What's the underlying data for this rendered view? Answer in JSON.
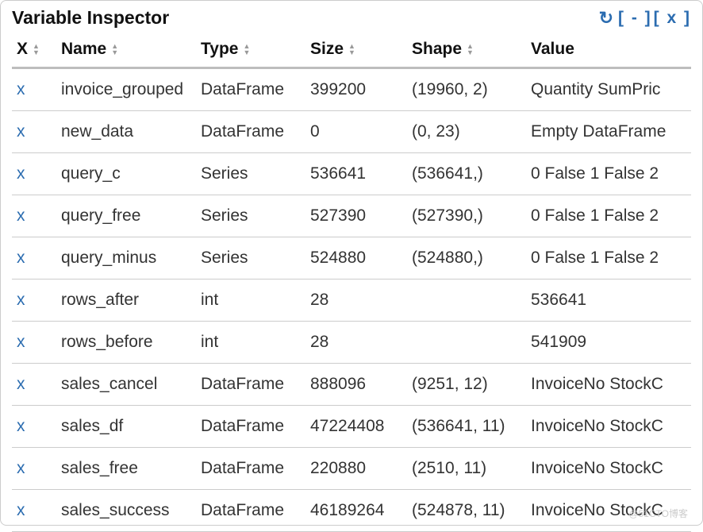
{
  "title": "Variable Inspector",
  "controls": {
    "reload_icon": "↻",
    "collapse": "[ - ]",
    "close": "[ x ]"
  },
  "columns": {
    "x": "X",
    "name": "Name",
    "type": "Type",
    "size": "Size",
    "shape": "Shape",
    "value": "Value"
  },
  "delete_glyph": "x",
  "rows": [
    {
      "name": "invoice_grouped",
      "type": "DataFrame",
      "size": "399200",
      "shape": "(19960, 2)",
      "value": "Quantity SumPric"
    },
    {
      "name": "new_data",
      "type": "DataFrame",
      "size": "0",
      "shape": "(0, 23)",
      "value": "Empty DataFrame"
    },
    {
      "name": "query_c",
      "type": "Series",
      "size": "536641",
      "shape": "(536641,)",
      "value": "0 False 1 False 2"
    },
    {
      "name": "query_free",
      "type": "Series",
      "size": "527390",
      "shape": "(527390,)",
      "value": "0 False 1 False 2"
    },
    {
      "name": "query_minus",
      "type": "Series",
      "size": "524880",
      "shape": "(524880,)",
      "value": "0 False 1 False 2"
    },
    {
      "name": "rows_after",
      "type": "int",
      "size": "28",
      "shape": "",
      "value": "536641"
    },
    {
      "name": "rows_before",
      "type": "int",
      "size": "28",
      "shape": "",
      "value": "541909"
    },
    {
      "name": "sales_cancel",
      "type": "DataFrame",
      "size": "888096",
      "shape": "(9251, 12)",
      "value": "InvoiceNo StockC"
    },
    {
      "name": "sales_df",
      "type": "DataFrame",
      "size": "47224408",
      "shape": "(536641, 11)",
      "value": "InvoiceNo StockC"
    },
    {
      "name": "sales_free",
      "type": "DataFrame",
      "size": "220880",
      "shape": "(2510, 11)",
      "value": "InvoiceNo StockC"
    },
    {
      "name": "sales_success",
      "type": "DataFrame",
      "size": "46189264",
      "shape": "(524878, 11)",
      "value": "InvoiceNo StockC"
    }
  ],
  "watermark": "@51CTO博客"
}
